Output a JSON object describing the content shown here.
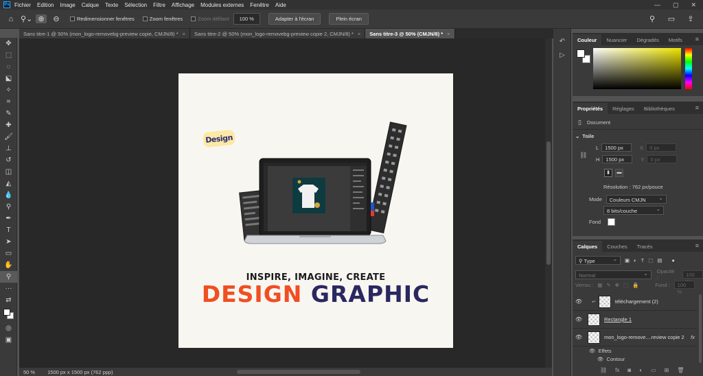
{
  "app": {
    "logo": "Ps"
  },
  "menubar": {
    "items": [
      "Fichier",
      "Edition",
      "Image",
      "Calque",
      "Texte",
      "Sélection",
      "Filtre",
      "Affichage",
      "Modules externes",
      "Fenêtre",
      "Aide"
    ],
    "window_controls": [
      "—",
      "▢",
      "✕"
    ]
  },
  "options": {
    "resize_windows": "Redimensionner fenêtres",
    "zoom_windows": "Zoom fenêtres",
    "scrubby_zoom": "Zoom défilant",
    "zoom_value": "100 %",
    "fit_screen": "Adapter à l'écran",
    "fill_screen": "Plein écran"
  },
  "tabs": [
    {
      "label": "Sans titre-1 @ 50% (mon_logo-removebg-preview copie, CMJN/8) *",
      "active": false
    },
    {
      "label": "Sans titre-2 @ 50% (mon_logo-removebg-preview copie 2, CMJN/8) *",
      "active": false
    },
    {
      "label": "Sans titre-3 @ 50% (CMJN/8) *",
      "active": true
    }
  ],
  "tab_close": "×",
  "document": {
    "logo_text": "Design",
    "tagline": "INSPIRE, IMAGINE, CREATE",
    "headline_word1": "DESIGN",
    "headline_word2": "GRAPHIC"
  },
  "status": {
    "zoom": "50 %",
    "doc_info": "1500 px x 1500 px (762 ppp)"
  },
  "color_panel": {
    "tabs": [
      "Couleur",
      "Nuancier",
      "Dégradés",
      "Motifs"
    ]
  },
  "properties_panel": {
    "tabs": [
      "Propriétés",
      "Réglages",
      "Bibliothèques"
    ],
    "section": "Document",
    "canvas_label": "Toile",
    "w_label": "L",
    "w_value": "1500 px",
    "h_label": "H",
    "h_value": "1500 px",
    "x_label": "X",
    "x_value": "0 px",
    "y_label": "Y",
    "y_value": "0 px",
    "resolution": "Résolution : 762 px/pouce",
    "mode_label": "Mode",
    "mode_value": "Couleurs CMJN",
    "bits_value": "8 bits/couche",
    "bg_label": "Fond"
  },
  "layers_panel": {
    "tabs": [
      "Calques",
      "Couches",
      "Tracés"
    ],
    "filter": "Type",
    "blend_mode": "Normal",
    "opacity_label": "Opacité :",
    "opacity_value": "100 %",
    "lock_label": "Verrou :",
    "fill_label": "Fond :",
    "fill_value": "100 %",
    "layers": [
      {
        "name": "téléchargement (2)"
      },
      {
        "name": "Rectangle 1"
      },
      {
        "name": "mon_logo-remove....review copie 2",
        "fx": "fx"
      }
    ],
    "effects_label": "Effets",
    "effect_item": "Contour"
  }
}
